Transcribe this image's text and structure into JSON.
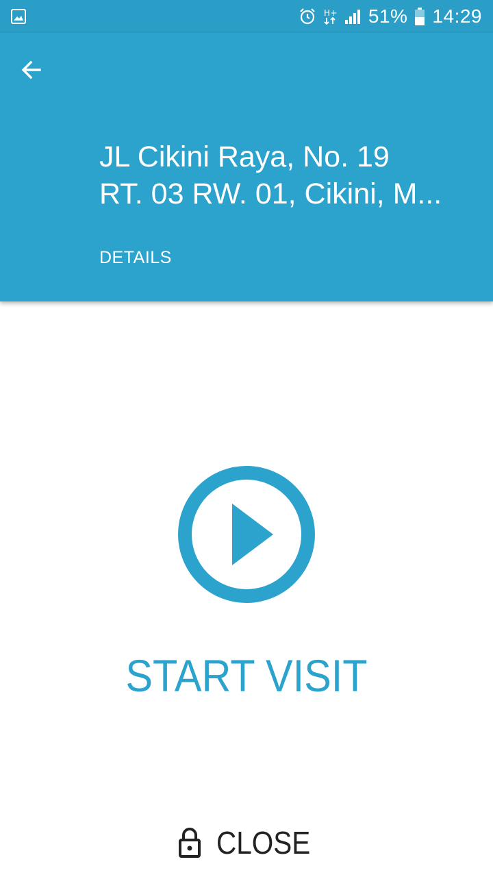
{
  "status_bar": {
    "gallery_icon": "image-icon",
    "alarm_icon": "alarm-icon",
    "network_label": "H+",
    "signal_icon": "signal-icon",
    "battery_percent": "51%",
    "battery_icon": "battery-icon",
    "time": "14:29"
  },
  "header": {
    "back_icon": "arrow-left-icon",
    "address_line1": "JL Cikini Raya, No. 19",
    "address_line2": "RT. 03 RW. 01, Cikini, M...",
    "details_label": "DETAILS"
  },
  "main": {
    "play_icon": "play-circle-icon",
    "start_label": "START VISIT"
  },
  "footer": {
    "lock_icon": "lock-icon",
    "close_label": "CLOSE"
  },
  "colors": {
    "primary": "#2ba3cc",
    "status_bar": "#2a9ec6",
    "text_dark": "#222222"
  }
}
